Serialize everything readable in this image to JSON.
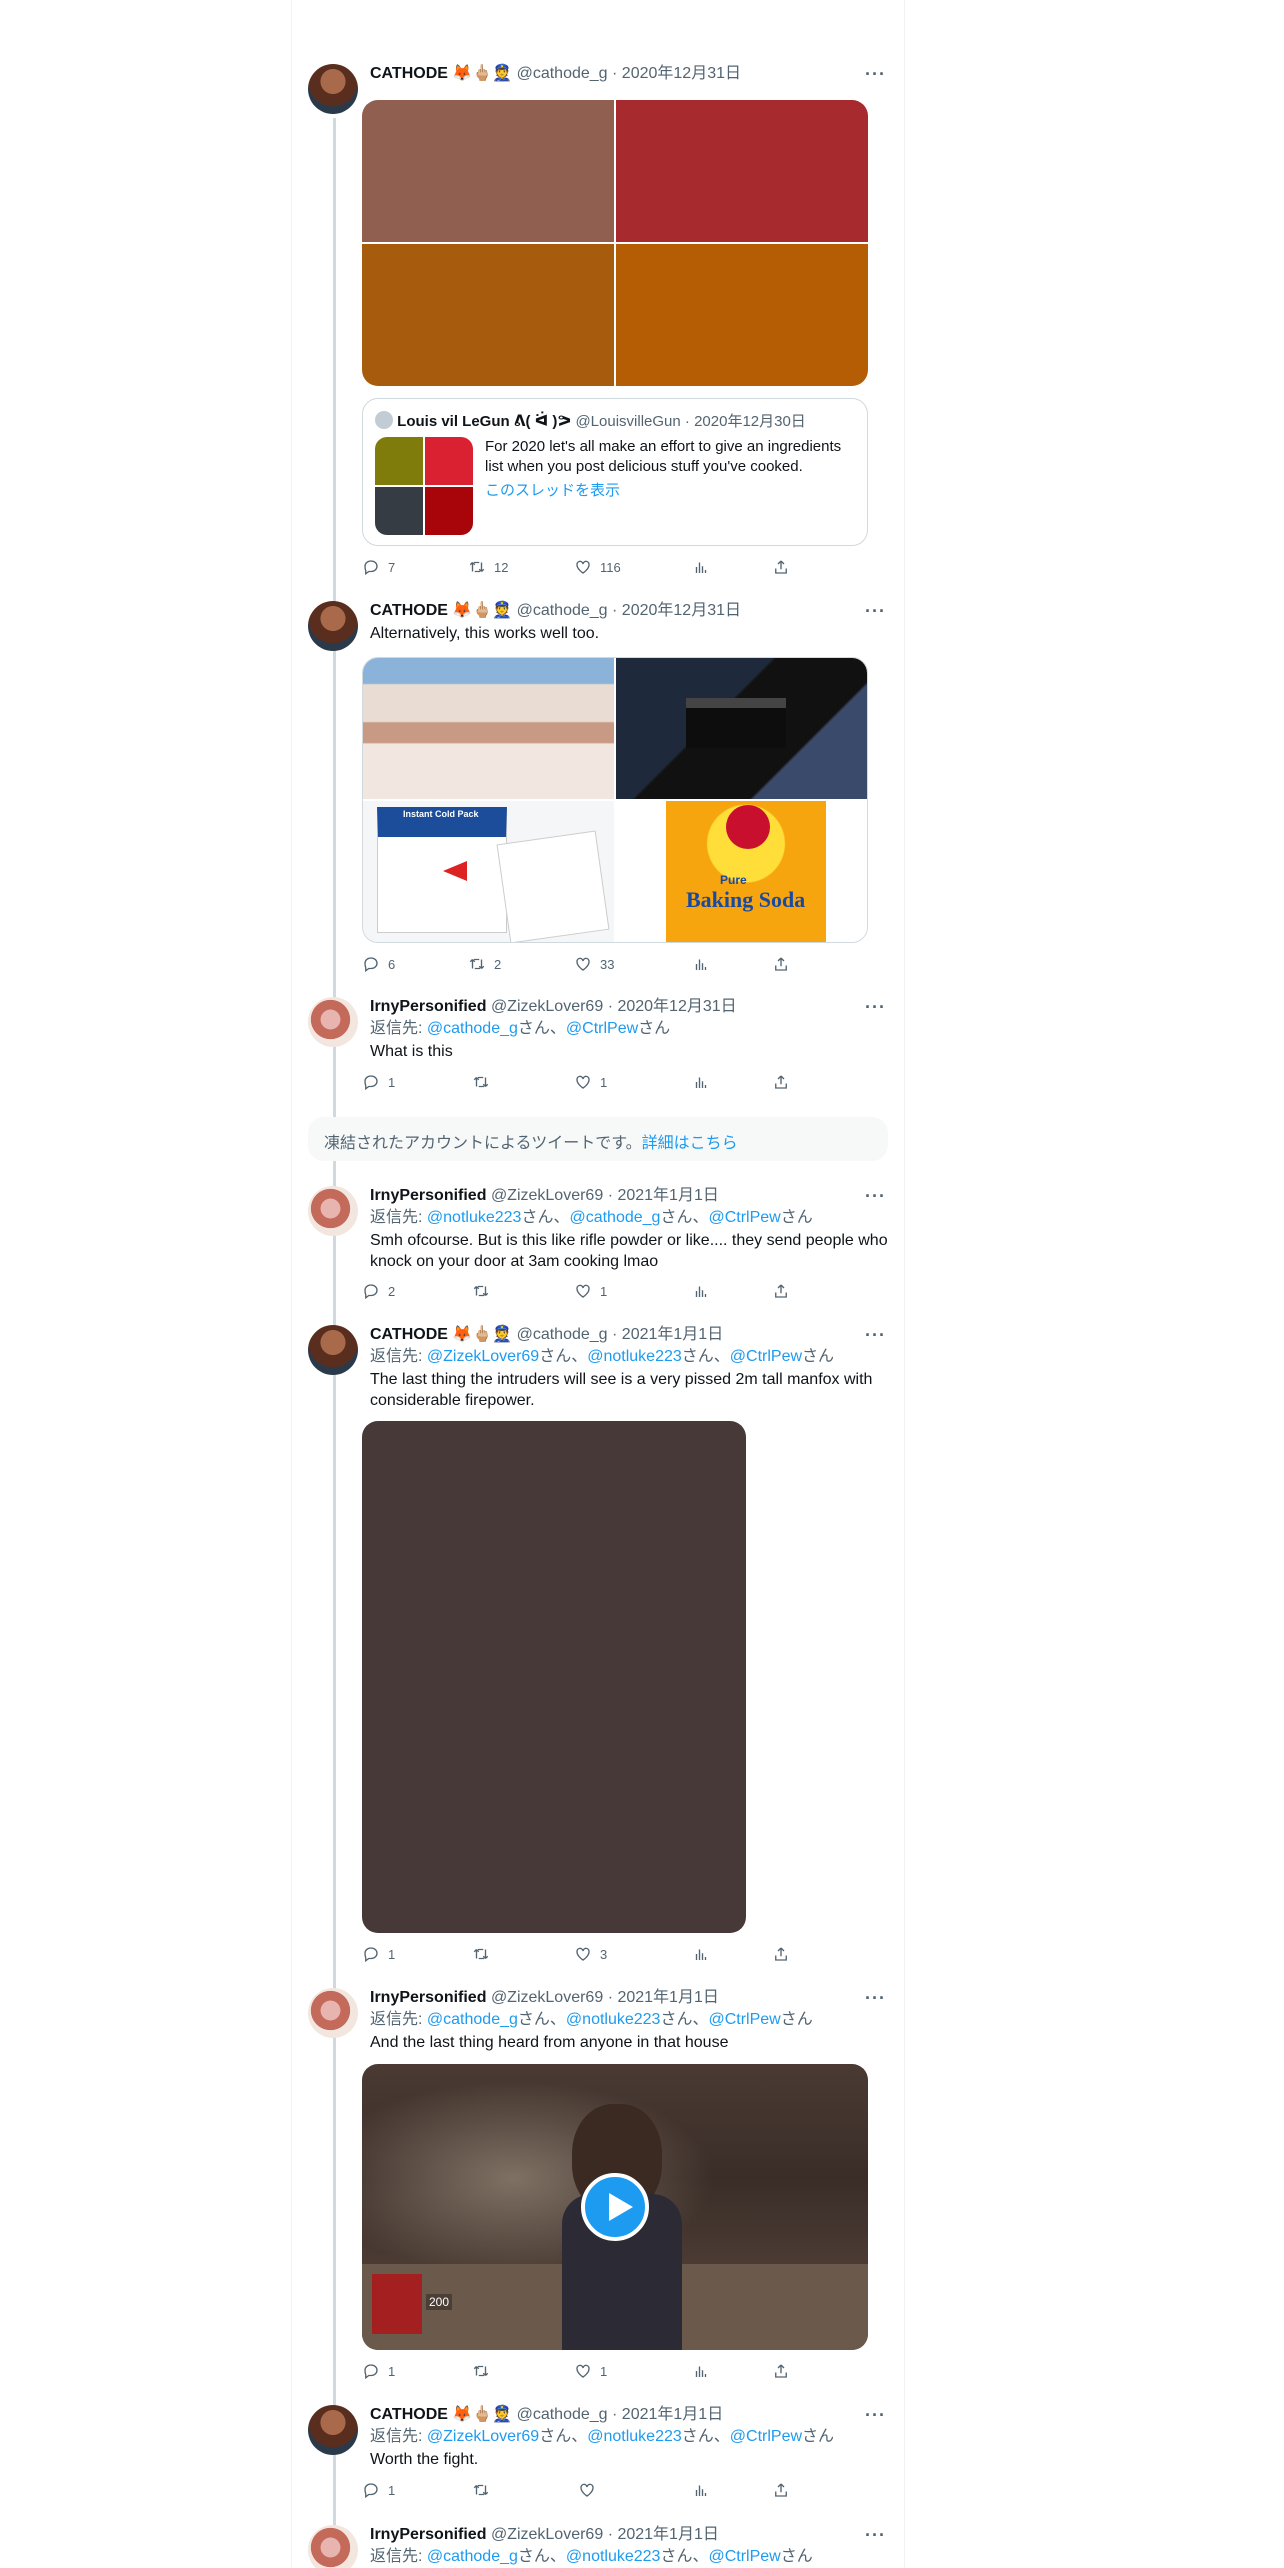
{
  "tweets": [
    {
      "name": "CATHODE 🦊🖕🏼👮",
      "handle": "@cathode_g",
      "date": "· 2020年12月31日",
      "replies": "7",
      "retweets": "12",
      "likes": "116",
      "quote": {
        "name": "Louis vil LeGun ᕕ( ᐛ )ᕗ",
        "handle": "@LouisvilleGun",
        "date": "· 2020年12月30日",
        "text": "For 2020 let's all make an effort to give an ingredients list when you post delicious stuff you've cooked.",
        "thread_link": "このスレッドを表示"
      }
    },
    {
      "name": "CATHODE 🦊🖕🏼👮",
      "handle": "@cathode_g",
      "date": "· 2020年12月31日",
      "text": "Alternatively, this works well too.",
      "replies": "6",
      "retweets": "2",
      "likes": "33",
      "image_labels": {
        "cold_pack": "Instant Cold Pack",
        "baking_soda": "Baking Soda",
        "pure": "Pure"
      }
    },
    {
      "name": "IrnyPersonified",
      "handle": "@ZizekLover69",
      "date": "· 2020年12月31日",
      "reply_prefix": "返信先: ",
      "mentions": [
        "@cathode_g",
        "@CtrlPew"
      ],
      "san": "さん",
      "sep": "、",
      "text": "What is this",
      "replies": "1",
      "retweets": "",
      "likes": "1"
    },
    {
      "name": "IrnyPersonified",
      "handle": "@ZizekLover69",
      "date": "· 2021年1月1日",
      "reply_prefix": "返信先: ",
      "mentions": [
        "@notluke223",
        "@cathode_g",
        "@CtrlPew"
      ],
      "text": "Smh ofcourse. But is this like rifle powder or like.... they send people who knock on your door at 3am cooking lmao",
      "replies": "2",
      "retweets": "",
      "likes": "1"
    },
    {
      "name": "CATHODE 🦊🖕🏼👮",
      "handle": "@cathode_g",
      "date": "· 2021年1月1日",
      "reply_prefix": "返信先: ",
      "mentions": [
        "@ZizekLover69",
        "@notluke223",
        "@CtrlPew"
      ],
      "text": "The last thing the intruders will see is a very pissed 2m tall manfox with considerable firepower.",
      "replies": "1",
      "retweets": "",
      "likes": "3"
    },
    {
      "name": "IrnyPersonified",
      "handle": "@ZizekLover69",
      "date": "· 2021年1月1日",
      "reply_prefix": "返信先: ",
      "mentions": [
        "@cathode_g",
        "@notluke223",
        "@CtrlPew"
      ],
      "text": "And the last thing heard from anyone in that house",
      "replies": "1",
      "retweets": "",
      "likes": "1",
      "video_badge": "200"
    },
    {
      "name": "CATHODE 🦊🖕🏼👮",
      "handle": "@cathode_g",
      "date": "· 2021年1月1日",
      "reply_prefix": "返信先: ",
      "mentions": [
        "@ZizekLover69",
        "@notluke223",
        "@CtrlPew"
      ],
      "text": "Worth the fight.",
      "replies": "1",
      "retweets": "",
      "likes": ""
    },
    {
      "name": "IrnyPersonified",
      "handle": "@ZizekLover69",
      "date": "· 2021年1月1日",
      "reply_prefix": "返信先: ",
      "mentions": [
        "@cathode_g",
        "@notluke223",
        "@CtrlPew"
      ]
    }
  ],
  "suspended": {
    "text": "凍結されたアカウントによるツイートです。",
    "link": "詳細はこちら"
  },
  "more_label": "···",
  "colors": {
    "accent": "#1d9bf0",
    "meta": "#536471",
    "border": "#cfd9de"
  }
}
